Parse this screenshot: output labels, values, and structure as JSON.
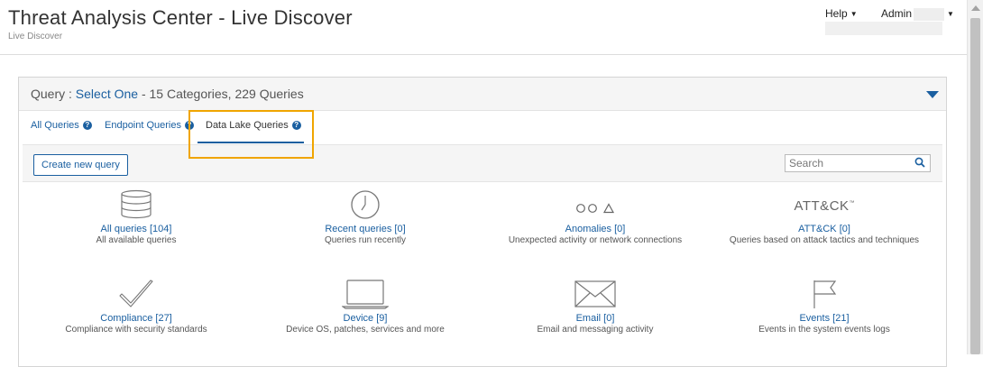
{
  "header": {
    "title": "Threat Analysis Center - Live Discover",
    "subtitle": "Live Discover",
    "help_label": "Help",
    "admin_label": "Admin"
  },
  "panel": {
    "query_prefix": "Query :",
    "query_select": "Select One",
    "query_summary": "- 15 Categories, 229 Queries"
  },
  "tabs": [
    {
      "label": "All Queries",
      "active": false
    },
    {
      "label": "Endpoint Queries",
      "active": false
    },
    {
      "label": "Data Lake Queries",
      "active": true
    }
  ],
  "toolbar": {
    "create_label": "Create new query",
    "search_placeholder": "Search"
  },
  "categories": [
    {
      "icon": "database-icon",
      "title": "All queries [104]",
      "desc": "All available queries"
    },
    {
      "icon": "clock-icon",
      "title": "Recent queries [0]",
      "desc": "Queries run recently"
    },
    {
      "icon": "shapes-icon",
      "title": "Anomalies [0]",
      "desc": "Unexpected activity or network connections"
    },
    {
      "icon": "attck-logo-icon",
      "icon_text": "ATT&CK",
      "icon_tm": "™",
      "title": "ATT&CK [0]",
      "desc": "Queries based on attack tactics and techniques"
    },
    {
      "icon": "checkmark-icon",
      "title": "Compliance [27]",
      "desc": "Compliance with security standards"
    },
    {
      "icon": "laptop-icon",
      "title": "Device [9]",
      "desc": "Device OS, patches, services and more"
    },
    {
      "icon": "envelope-icon",
      "title": "Email [0]",
      "desc": "Email and messaging activity"
    },
    {
      "icon": "flag-icon",
      "title": "Events [21]",
      "desc": "Events in the system events logs"
    }
  ],
  "colors": {
    "accent": "#1a5fa0",
    "highlight": "#f0a500"
  }
}
